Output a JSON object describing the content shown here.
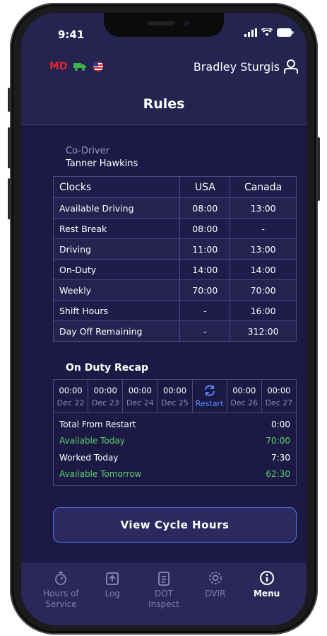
{
  "status_bar": {
    "time": "9:41"
  },
  "topbar": {
    "badge": "MD",
    "username": "Bradley Sturgis"
  },
  "page": {
    "title": "Rules"
  },
  "codriver": {
    "label": "Co-Driver",
    "name": "Tanner Hawkins"
  },
  "clocks": {
    "headers": [
      "Clocks",
      "USA",
      "Canada"
    ],
    "rows": [
      [
        "Available Driving",
        "08:00",
        "13:00"
      ],
      [
        "Rest Break",
        "08:00",
        "-"
      ],
      [
        "Driving",
        "11:00",
        "13:00"
      ],
      [
        "On-Duty",
        "14:00",
        "14:00"
      ],
      [
        "Weekly",
        "70:00",
        "70:00"
      ],
      [
        "Shift Hours",
        "-",
        "16:00"
      ],
      [
        "Day Off Remaining",
        "-",
        "312:00"
      ]
    ]
  },
  "recap": {
    "title": "On Duty Recap",
    "days": [
      {
        "time": "00:00",
        "date": "Dec 22"
      },
      {
        "time": "00:00",
        "date": "Dec 23"
      },
      {
        "time": "00:00",
        "date": "Dec 24"
      },
      {
        "time": "00:00",
        "date": "Dec 25"
      },
      {
        "time": "",
        "date": "Restart"
      },
      {
        "time": "00:00",
        "date": "Dec 26"
      },
      {
        "time": "00:00",
        "date": "Dec 27"
      }
    ],
    "totals": [
      {
        "label": "Total From Restart",
        "value": "0:00"
      },
      {
        "label": "Available Today",
        "value": "70:00"
      },
      {
        "label": "Worked Today",
        "value": "7:30"
      },
      {
        "label": "Available Tomorrow",
        "value": "62:30"
      }
    ]
  },
  "cycle_button": "View Cycle Hours",
  "nav": [
    {
      "label": "Hours of Service",
      "icon": "stopwatch-icon"
    },
    {
      "label": "Log",
      "icon": "log-upload-icon"
    },
    {
      "label": "DOT Inspect",
      "icon": "clipboard-icon"
    },
    {
      "label": "DVIR",
      "icon": "gear-icon"
    },
    {
      "label": "Menu",
      "icon": "info-icon"
    }
  ],
  "colors": {
    "background": "#252350",
    "content": "#1c1a45",
    "accent": "#4a78e0",
    "green": "#5bd16a",
    "red": "#e0262f"
  }
}
